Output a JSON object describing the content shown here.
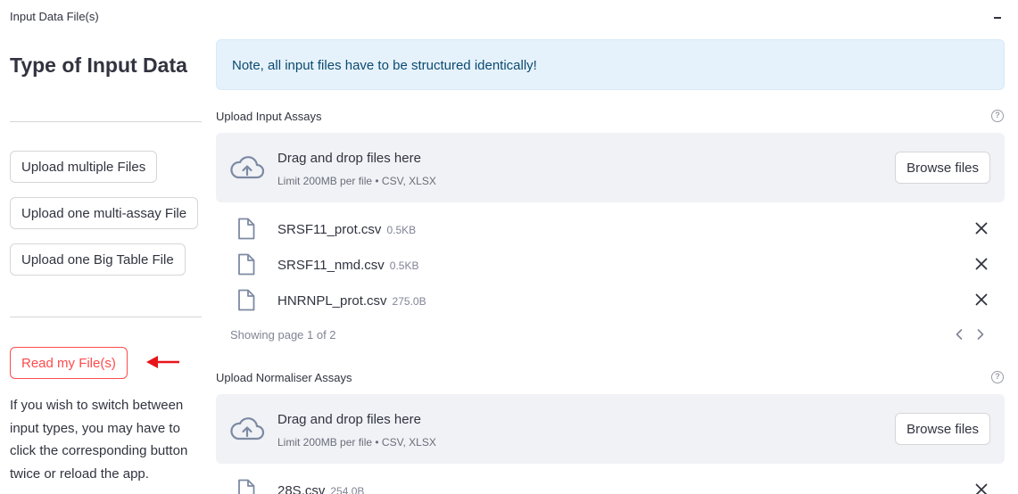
{
  "expander": {
    "title": "Input Data File(s)",
    "collapse_icon": "minus-icon"
  },
  "left": {
    "section_title": "Type of Input Data",
    "buttons": {
      "multiple_files": "Upload multiple Files",
      "multi_assay": "Upload one multi-assay File",
      "big_table": "Upload one Big Table File",
      "read_files": "Read my File(s)"
    },
    "info_text": "If you wish to switch between input types, you may have to click the corresponding button twice or reload the app."
  },
  "note": "Note, all input files have to be structured identically!",
  "uploaders": [
    {
      "label": "Upload Input Assays",
      "dropzone_title": "Drag and drop files here",
      "dropzone_limit": "Limit 200MB per file • CSV, XLSX",
      "browse_label": "Browse files",
      "files": [
        {
          "name": "SRSF11_prot.csv",
          "size": "0.5KB"
        },
        {
          "name": "SRSF11_nmd.csv",
          "size": "0.5KB"
        },
        {
          "name": "HNRNPL_prot.csv",
          "size": "275.0B"
        }
      ],
      "pagination": "Showing page 1 of 2"
    },
    {
      "label": "Upload Normaliser Assays",
      "dropzone_title": "Drag and drop files here",
      "dropzone_limit": "Limit 200MB per file • CSV, XLSX",
      "browse_label": "Browse files",
      "files": [
        {
          "name": "28S.csv",
          "size": "254.0B"
        }
      ]
    }
  ],
  "colors": {
    "primary_red": "#ff4b4b",
    "note_bg": "#e6f2fb",
    "note_text": "#0b4a6f",
    "dropzone_bg": "#f0f2f6",
    "annotation_arrow": "#e8141b"
  }
}
